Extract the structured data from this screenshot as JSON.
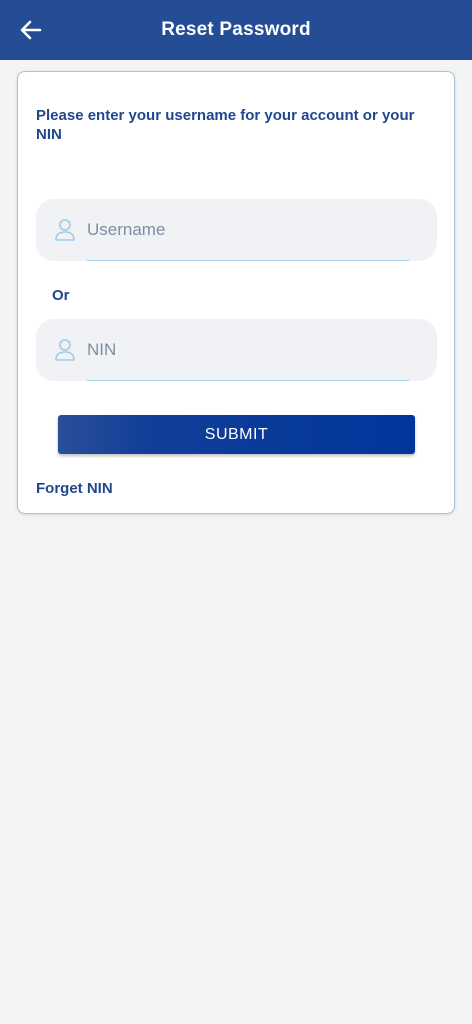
{
  "header": {
    "title": "Reset Password",
    "back_icon": "arrow-left-icon",
    "background": "#244d96"
  },
  "form": {
    "instruction": "Please enter your username for your account or your NIN",
    "username": {
      "placeholder": "Username",
      "value": "",
      "icon": "person-icon"
    },
    "or_label": "Or",
    "nin": {
      "placeholder": "NIN",
      "value": "",
      "icon": "person-icon"
    },
    "submit_label": "SUBMIT",
    "forget_label": "Forget NIN"
  },
  "colors": {
    "accent": "#21478f",
    "button": "#00369c",
    "field_bg": "#f0f2f5",
    "page_bg": "#f4f4f4"
  }
}
